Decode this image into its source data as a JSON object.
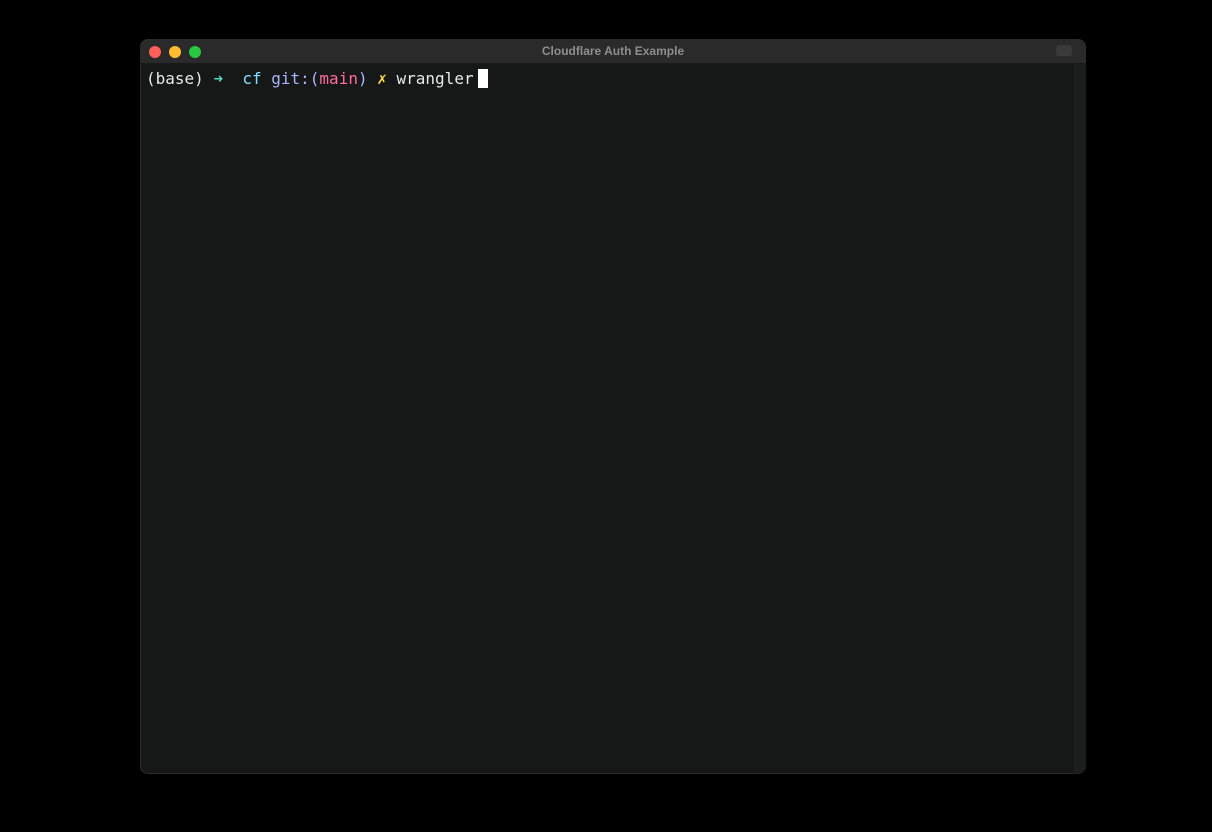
{
  "window": {
    "title": "Cloudflare Auth Example"
  },
  "terminal": {
    "env": "(base)",
    "arrow": "➜",
    "dir": "cf",
    "git_prefix": "git:(",
    "branch": "main",
    "git_suffix": ")",
    "dirty_mark": "✗",
    "command": "wrangler"
  },
  "colors": {
    "close": "#fe5f57",
    "minimize": "#febc2e",
    "zoom": "#28c840",
    "arrow": "#4fd6be",
    "dir": "#7fe0ff",
    "git": "#a9b4ff",
    "branch": "#ff6b9d",
    "dirty": "#ffd84a",
    "cursor": "#ffffff"
  },
  "icons": {
    "close": "close-icon",
    "minimize": "minimize-icon",
    "zoom": "zoom-icon"
  }
}
